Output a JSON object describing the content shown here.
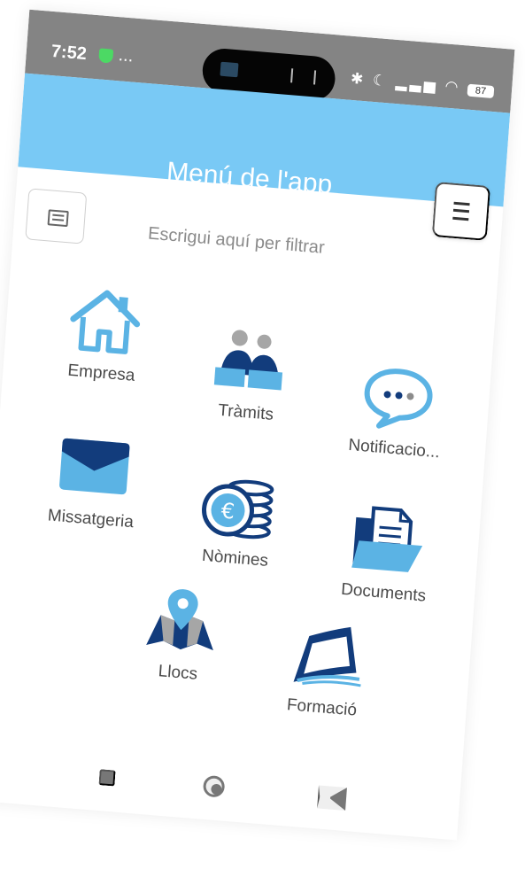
{
  "status_bar": {
    "time": "7:52",
    "dots": "...",
    "icons": "✱ ☾ ▂▃▅ ◠",
    "battery": "87"
  },
  "header": {
    "title": "Menú de l'app"
  },
  "filter": {
    "placeholder": "Escrigui aquí per filtrar"
  },
  "menu_items": [
    {
      "label": "Empresa"
    },
    {
      "label": "Tràmits"
    },
    {
      "label": "Notificacio..."
    },
    {
      "label": "Missatgeria"
    },
    {
      "label": "Nòmines"
    },
    {
      "label": "Documents"
    },
    {
      "label": "Llocs"
    },
    {
      "label": "Formació"
    }
  ],
  "colors": {
    "accent": "#79c9f5",
    "status_bar": "#848484",
    "icon_dark": "#123c7c",
    "icon_light": "#5bb3e4"
  }
}
